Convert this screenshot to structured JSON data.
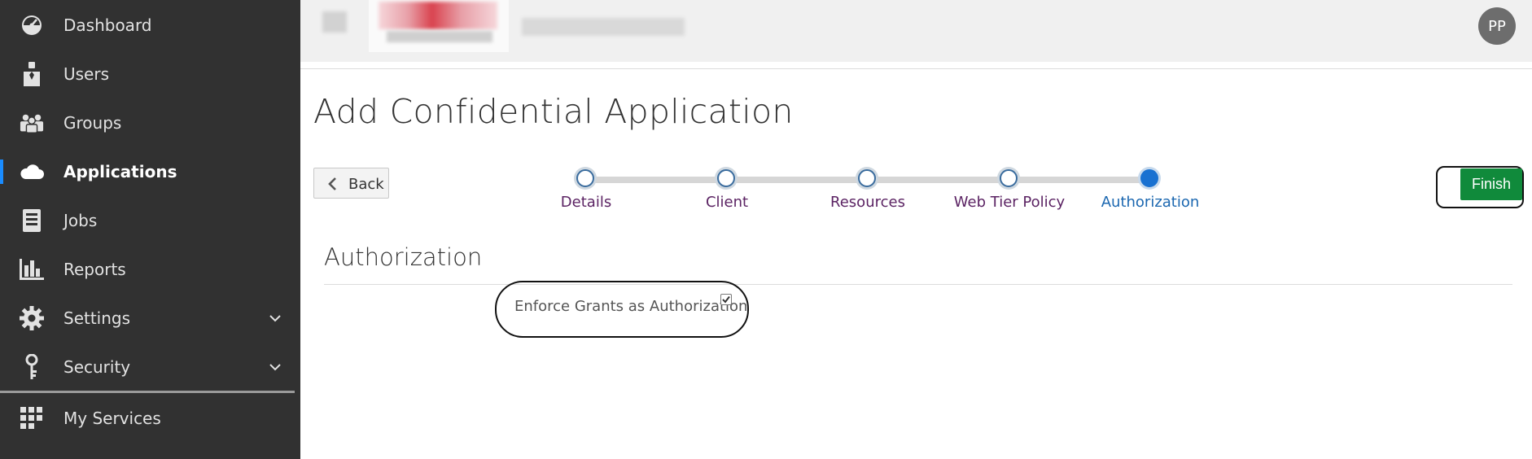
{
  "sidebar": {
    "items": [
      {
        "label": "Dashboard",
        "icon": "dashboard-icon"
      },
      {
        "label": "Users",
        "icon": "user-icon"
      },
      {
        "label": "Groups",
        "icon": "groups-icon"
      },
      {
        "label": "Applications",
        "icon": "cloud-icon",
        "active": true
      },
      {
        "label": "Jobs",
        "icon": "jobs-icon"
      },
      {
        "label": "Reports",
        "icon": "reports-icon"
      },
      {
        "label": "Settings",
        "icon": "gear-icon",
        "expandable": true
      },
      {
        "label": "Security",
        "icon": "key-icon",
        "expandable": true
      }
    ],
    "my_services": {
      "label": "My Services",
      "icon": "grid-icon"
    }
  },
  "header": {
    "avatar_initials": "PP"
  },
  "main": {
    "title": "Add Confidential Application",
    "back_label": "Back",
    "finish_label": "Finish",
    "train": [
      {
        "label": "Details",
        "state": "visited"
      },
      {
        "label": "Client",
        "state": "visited"
      },
      {
        "label": "Resources",
        "state": "visited"
      },
      {
        "label": "Web Tier Policy",
        "state": "visited"
      },
      {
        "label": "Authorization",
        "state": "current"
      }
    ],
    "section_title": "Authorization",
    "enforce_grants_label": "Enforce Grants as Authorization",
    "enforce_grants_checked": true
  },
  "colors": {
    "sidebar_bg": "#313131",
    "accent_blue": "#1971d1",
    "finish_green": "#108a3b",
    "stop_label_purple": "#5b2363"
  }
}
